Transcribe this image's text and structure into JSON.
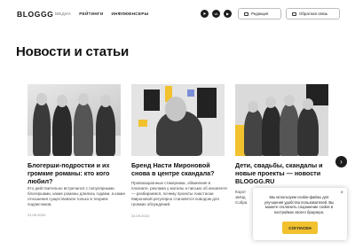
{
  "header": {
    "logo": "BLOGGG",
    "nav": [
      "МЕДИА",
      "РЕЙТИНГИ",
      "ИНФЛЮЕНСЕРЫ"
    ],
    "social": [
      {
        "name": "telegram-icon",
        "glyph": "➤"
      },
      {
        "name": "vk-icon",
        "glyph": "vk"
      },
      {
        "name": "youtube-icon",
        "glyph": "▶"
      }
    ],
    "editorial_label": "Редакция",
    "feedback_label": "Обратная связь"
  },
  "page_title": "Новости и статьи",
  "cards": [
    {
      "title": "Блогерши-подростки и их громкие романы: кто кого любил?",
      "desc": "Кто действительно встречался с популярными блогершами, какие романы длились годами, а какие отношения существовали только в теориях подписчиков.",
      "date": "21.09.2024"
    },
    {
      "title": "Бренд Насти Мироновой снова в центре скандала?",
      "desc": "Провокационные стикерники, обвинения в плагиате, реклама у могилы и письмо об иноагенте — разбираемся, почему проекты Анастасии Мироновой регулярно становятся поводом для громких обсуждений.",
      "date": "24.09.2024"
    },
    {
      "title": "Дети, свадьбы, скандалы и новые проекты — новости BLOGGG.RU",
      "desc": "Корот",
      "desc2": "звёзд",
      "desc3": "Собра"
    }
  ],
  "cookie": {
    "text": "Мы используем cookie-файлы для улучшения удобства пользователей. Вы можете отключить сохранение cookie в настройках своего браузера.",
    "accept_label": "СОГЛАСЕН",
    "close_glyph": "×"
  },
  "next_arrow_glyph": "›",
  "colors": {
    "accent": "#f2c12e",
    "text": "#111111",
    "muted": "#9a9a9a"
  }
}
